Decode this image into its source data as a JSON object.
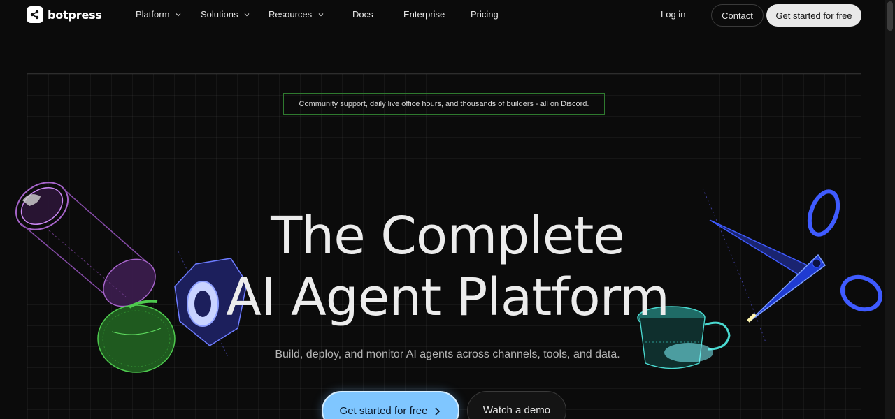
{
  "nav": {
    "brand": "botpress",
    "items": [
      {
        "label": "Platform",
        "has_dropdown": true
      },
      {
        "label": "Solutions",
        "has_dropdown": true
      },
      {
        "label": "Resources",
        "has_dropdown": true
      },
      {
        "label": "Docs",
        "has_dropdown": false
      },
      {
        "label": "Enterprise",
        "has_dropdown": false
      },
      {
        "label": "Pricing",
        "has_dropdown": false
      }
    ],
    "login_label": "Log in",
    "contact_label": "Contact",
    "get_started_label": "Get started for free"
  },
  "hero": {
    "banner_text": "Community support, daily live office hours, and thousands of builders - all on Discord.",
    "headline_line1": "The Complete",
    "headline_line2": "AI Agent Platform",
    "subtitle": "Build, deploy, and monitor AI agents across channels, tools, and data.",
    "cta_primary": "Get started for free",
    "cta_secondary": "Watch a demo"
  },
  "colors": {
    "background": "#0b0b0b",
    "accent_blue": "#7fc6ff",
    "banner_border": "#2f7a2f"
  },
  "icons": [
    "botpress-logo-icon",
    "chevron-down-icon",
    "chevron-right-icon"
  ]
}
